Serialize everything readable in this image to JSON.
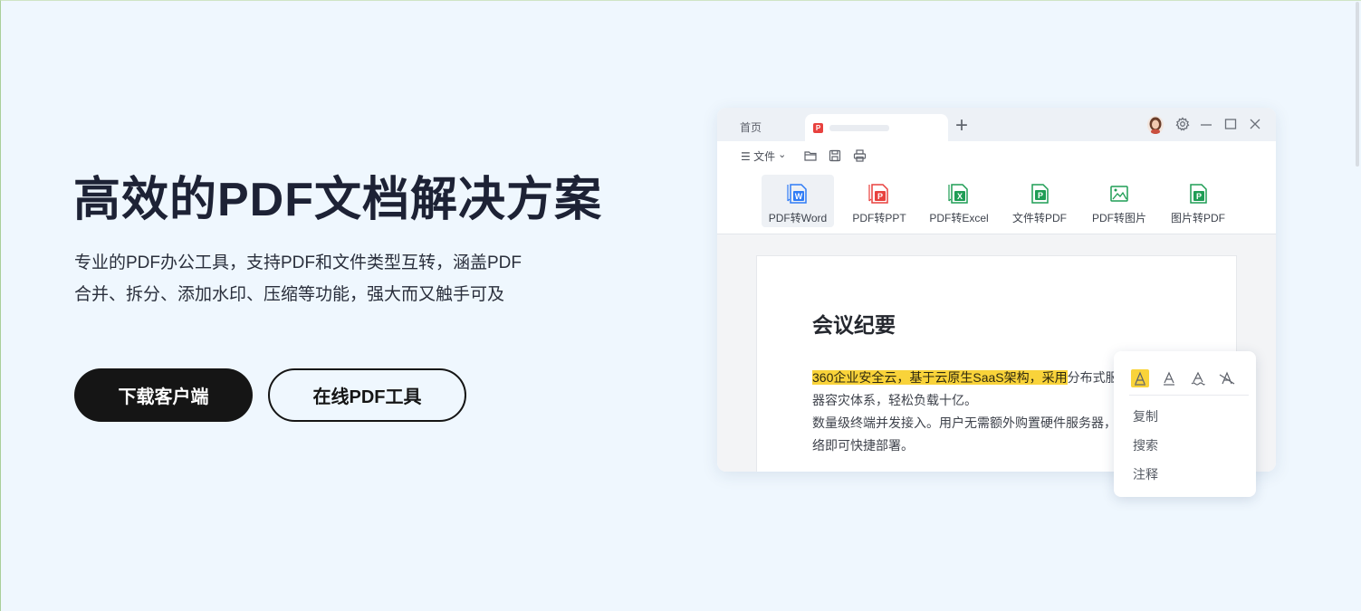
{
  "hero": {
    "title": "高效的PDF文档解决方案",
    "description_line1": "专业的PDF办公工具，支持PDF和文件类型互转，涵盖PDF",
    "description_line2": "合并、拆分、添加水印、压缩等功能，强大而又触手可及",
    "download_button": "下载客户端",
    "online_button": "在线PDF工具"
  },
  "app": {
    "tabs": {
      "home": "首页",
      "new_tab": "+"
    },
    "menu": {
      "file": "☰ 文件",
      "file_arrow": "⌄"
    },
    "toolbar": [
      {
        "label": "PDF转Word",
        "icon": "pdf-to-word-icon",
        "color": "#2f7cf6"
      },
      {
        "label": "PDF转PPT",
        "icon": "pdf-to-ppt-icon",
        "color": "#e8413e"
      },
      {
        "label": "PDF转Excel",
        "icon": "pdf-to-excel-icon",
        "color": "#1f9d55"
      },
      {
        "label": "文件转PDF",
        "icon": "file-to-pdf-icon",
        "color": "#1f9d55"
      },
      {
        "label": "PDF转图片",
        "icon": "pdf-to-image-icon",
        "color": "#1f9d55"
      },
      {
        "label": "图片转PDF",
        "icon": "image-to-pdf-icon",
        "color": "#1f9d55"
      }
    ],
    "document": {
      "heading": "会议纪要",
      "highlighted": "360企业安全云，基于云原生SaaS架构，采用",
      "line1_rest": "分布式服务",
      "line2": "器容灾体系，轻松负载十亿。",
      "line3": "数量级终端并发接入。用户无需额外购置硬件服务器，联网",
      "line4": "络即可快捷部署。"
    }
  },
  "popup": {
    "items": [
      "复制",
      "搜索",
      "注释"
    ],
    "icons": [
      "highlight-icon",
      "underline-icon",
      "squiggly-icon",
      "strikethrough-icon"
    ]
  },
  "colors": {
    "background": "#eff7fe",
    "primary_button": "#151515",
    "highlight": "#f9d33a",
    "pdf_red": "#e8413e",
    "word_blue": "#2f7cf6",
    "excel_green": "#1f9d55"
  }
}
